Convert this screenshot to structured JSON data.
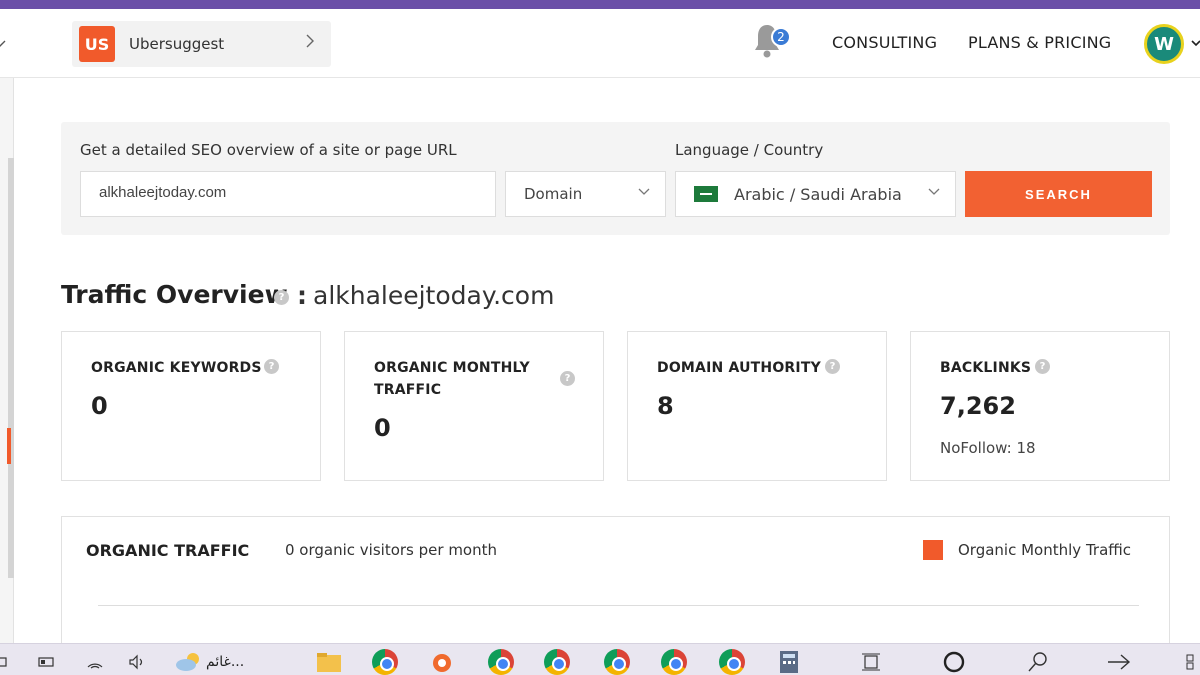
{
  "header": {
    "project_badge": "US",
    "project_name": "Ubersuggest",
    "notification_count": "2",
    "nav": [
      "CONSULTING",
      "PLANS & PRICING"
    ],
    "avatar_initial": "W"
  },
  "search": {
    "url_label": "Get a detailed SEO overview of a site or page URL",
    "url_value": "alkhaleejtoday.com",
    "scope_value": "Domain",
    "lang_label": "Language / Country",
    "lang_value": "Arabic / Saudi Arabia",
    "button_label": "SEARCH"
  },
  "overview": {
    "title": "Traffic Overview",
    "separator": ":",
    "domain": "alkhaleejtoday.com",
    "help_glyph": "?",
    "cards": [
      {
        "label_line1": "ORGANIC KEYWORDS",
        "label_line2": "",
        "value": "0",
        "sub": ""
      },
      {
        "label_line1": "ORGANIC MONTHLY",
        "label_line2": "TRAFFIC",
        "value": "0",
        "sub": ""
      },
      {
        "label_line1": "DOMAIN AUTHORITY",
        "label_line2": "",
        "value": "8",
        "sub": ""
      },
      {
        "label_line1": "BACKLINKS",
        "label_line2": "",
        "value": "7,262",
        "sub": "NoFollow: 18"
      }
    ]
  },
  "organic_traffic": {
    "title": "ORGANIC TRAFFIC",
    "subtitle": "0 organic visitors per month",
    "legend": "Organic Monthly Traffic",
    "legend_color": "#f15a2b"
  },
  "taskbar": {
    "weather_text": "غائم...",
    "icons": [
      "camera-icon",
      "battery-icon",
      "wifi-icon",
      "volume-icon",
      "weather-icon",
      "file-explorer-icon",
      "chrome-icon",
      "origin-icon",
      "chrome-icon",
      "chrome-icon",
      "chrome-icon",
      "chrome-icon",
      "chrome-icon",
      "calculator-icon",
      "task-view-icon",
      "cortana-icon",
      "search-icon",
      "arrow-icon",
      "windows-icon"
    ]
  },
  "colors": {
    "accent": "#f15a2b",
    "header_stripe": "#6b4fa8",
    "notification_badge": "#3a7bd5"
  }
}
